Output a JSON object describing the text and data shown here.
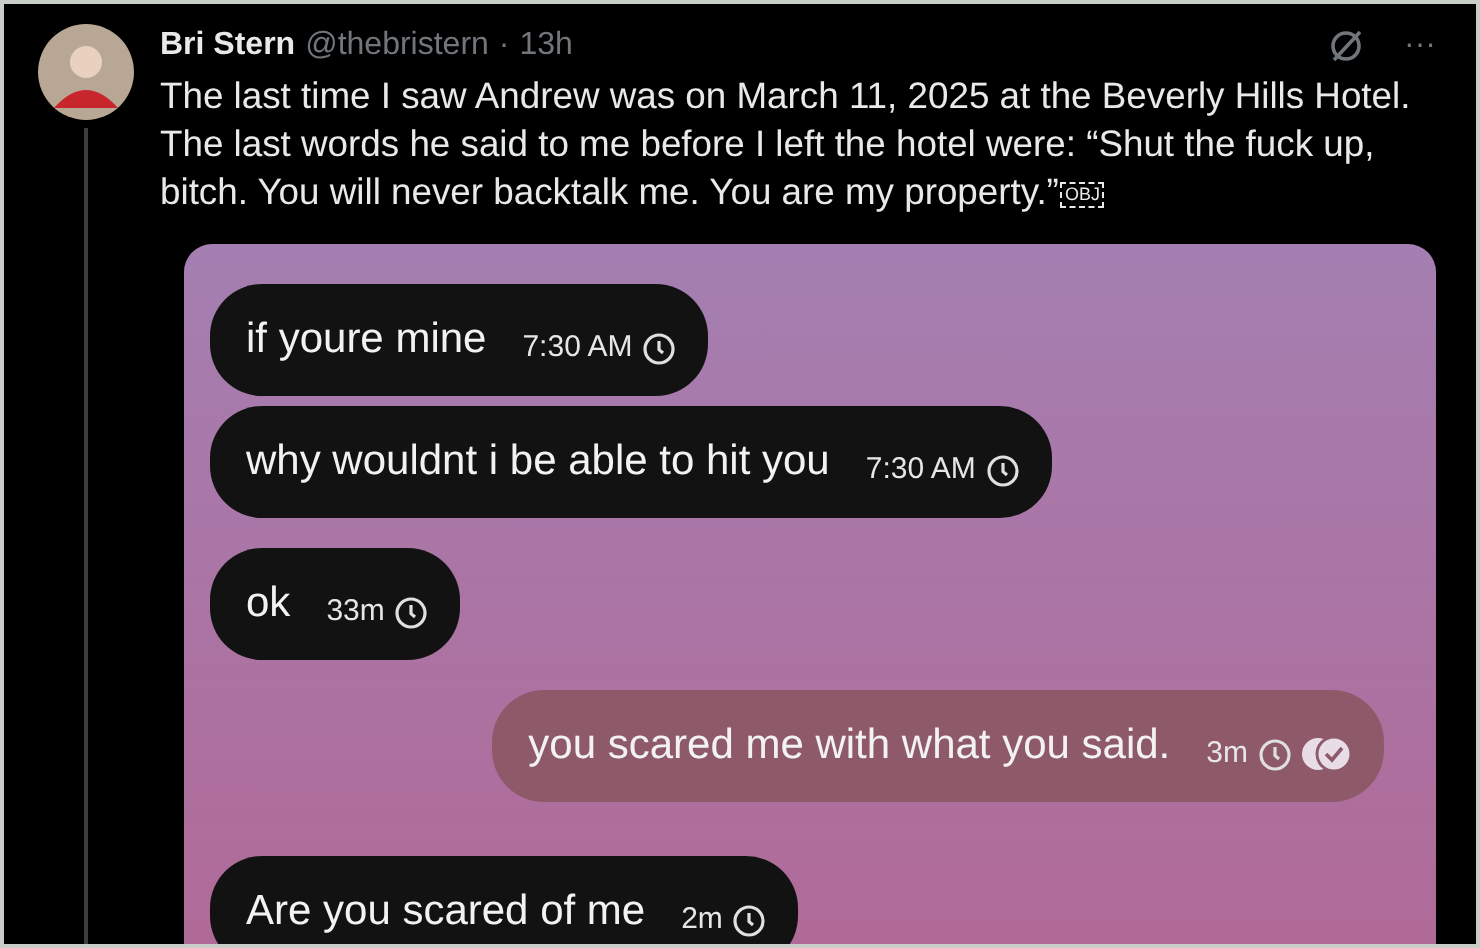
{
  "post": {
    "author": "Bri Stern",
    "handle": "@thebristern",
    "separator": "·",
    "time": "13h",
    "more": "···",
    "text": "The last time I saw Andrew was on March 11, 2025 at the Beverly Hills Hotel. The last words he said to me before I left the hotel were: “Shut the fuck up, bitch. You will never backtalk me. You are my property.”",
    "object_mark": "OBJ"
  },
  "chat": {
    "messages": [
      {
        "kind": "received",
        "text": "if youre mine",
        "time": "7:30 AM"
      },
      {
        "kind": "received",
        "text": "why wouldnt i be able to hit you",
        "time": "7:30 AM"
      },
      {
        "kind": "received",
        "text": "ok",
        "time": "33m"
      },
      {
        "kind": "sent",
        "text": "you scared me with what you said.",
        "time": "3m"
      },
      {
        "kind": "received",
        "text": "Are you scared of me",
        "time": "2m"
      }
    ]
  }
}
